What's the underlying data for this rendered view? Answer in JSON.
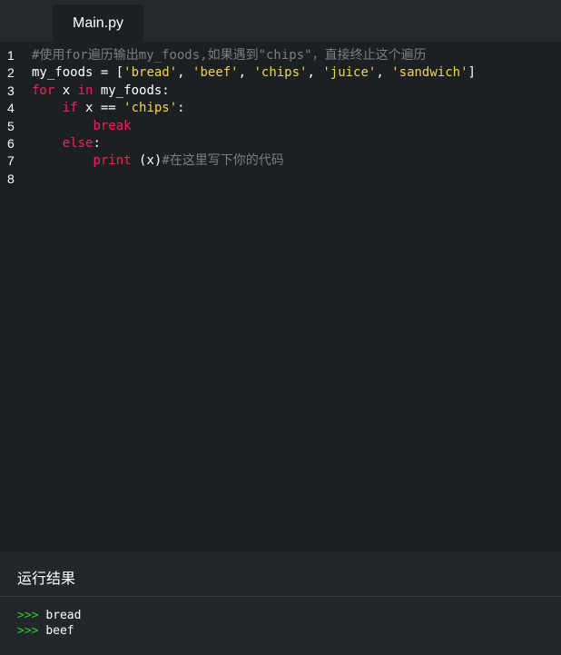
{
  "tab": {
    "label": "Main.py"
  },
  "editor": {
    "lines": [
      {
        "number": "1",
        "tokens": [
          {
            "type": "comment",
            "text": "#使用for遍历输出my_foods,如果遇到\"chips\"，直接终止这个遍历"
          }
        ]
      },
      {
        "number": "2",
        "tokens": [
          {
            "type": "plain",
            "text": "my_foods = ["
          },
          {
            "type": "string",
            "text": "'bread'"
          },
          {
            "type": "plain",
            "text": ", "
          },
          {
            "type": "string",
            "text": "'beef'"
          },
          {
            "type": "plain",
            "text": ", "
          },
          {
            "type": "string",
            "text": "'chips'"
          },
          {
            "type": "plain",
            "text": ", "
          },
          {
            "type": "string",
            "text": "'juice'"
          },
          {
            "type": "plain",
            "text": ", "
          },
          {
            "type": "string",
            "text": "'sandwich'"
          },
          {
            "type": "plain",
            "text": "]"
          }
        ]
      },
      {
        "number": "3",
        "tokens": [
          {
            "type": "keyword",
            "text": "for"
          },
          {
            "type": "plain",
            "text": " x "
          },
          {
            "type": "keyword",
            "text": "in"
          },
          {
            "type": "plain",
            "text": " my_foods:"
          }
        ]
      },
      {
        "number": "4",
        "tokens": [
          {
            "type": "plain",
            "text": "    "
          },
          {
            "type": "keyword",
            "text": "if"
          },
          {
            "type": "plain",
            "text": " x == "
          },
          {
            "type": "string",
            "text": "'chips'"
          },
          {
            "type": "plain",
            "text": ":"
          }
        ]
      },
      {
        "number": "5",
        "tokens": [
          {
            "type": "plain",
            "text": "        "
          },
          {
            "type": "keyword",
            "text": "break"
          }
        ]
      },
      {
        "number": "6",
        "tokens": [
          {
            "type": "plain",
            "text": "    "
          },
          {
            "type": "keyword",
            "text": "else"
          },
          {
            "type": "plain",
            "text": ":"
          }
        ]
      },
      {
        "number": "7",
        "tokens": [
          {
            "type": "plain",
            "text": "        "
          },
          {
            "type": "keyword",
            "text": "print"
          },
          {
            "type": "plain",
            "text": " (x)"
          },
          {
            "type": "comment",
            "text": "#在这里写下你的代码"
          }
        ]
      },
      {
        "number": "8",
        "tokens": []
      }
    ]
  },
  "results": {
    "title": "运行结果",
    "output": [
      {
        "prompt": ">>>",
        "text": "bread"
      },
      {
        "prompt": ">>>",
        "text": "beef"
      }
    ]
  },
  "colors": {
    "keyword": "#f0245a",
    "string": "#f2d54b",
    "comment": "#7a7e83",
    "prompt": "#2fc92f",
    "editor_bg": "#1d2023",
    "tabbar_bg": "#262a2e",
    "results_bg": "#22272b"
  }
}
